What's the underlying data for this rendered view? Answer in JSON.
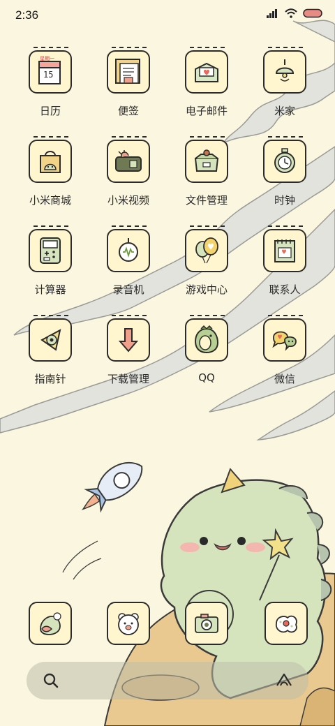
{
  "status_bar": {
    "time": "2:36",
    "battery_color": "#e88b85"
  },
  "apps": [
    {
      "label": "日历",
      "icon": "calendar-icon",
      "badge_text": "星期一",
      "day": "15"
    },
    {
      "label": "便签",
      "icon": "notes-icon"
    },
    {
      "label": "电子邮件",
      "icon": "email-icon"
    },
    {
      "label": "米家",
      "icon": "lamp-icon"
    },
    {
      "label": "小米商城",
      "icon": "shopping-bag-icon"
    },
    {
      "label": "小米视频",
      "icon": "video-icon"
    },
    {
      "label": "文件管理",
      "icon": "folder-box-icon"
    },
    {
      "label": "时钟",
      "icon": "clock-icon"
    },
    {
      "label": "计算器",
      "icon": "calculator-icon"
    },
    {
      "label": "录音机",
      "icon": "recorder-icon"
    },
    {
      "label": "游戏中心",
      "icon": "balloons-icon"
    },
    {
      "label": "联系人",
      "icon": "contacts-icon"
    },
    {
      "label": "指南针",
      "icon": "compass-icon"
    },
    {
      "label": "下载管理",
      "icon": "download-arrow-icon"
    },
    {
      "label": "QQ",
      "icon": "penguin-icon"
    },
    {
      "label": "微信",
      "icon": "chat-bubbles-icon"
    }
  ],
  "dock": [
    {
      "icon": "phone-heart-icon"
    },
    {
      "icon": "bear-face-icon"
    },
    {
      "icon": "camera-icon"
    },
    {
      "icon": "flower-browser-icon"
    }
  ],
  "search": {
    "left_icon": "search-icon",
    "right_icon": "assistant-icon"
  },
  "colors": {
    "background": "#fbf6df",
    "icon_fill": "#fff6cf",
    "icon_border": "#2b2b2b",
    "dino_green": "#d6e4bd",
    "cloud_gray": "#e2e2dc",
    "ground_tan": "#e9c98f"
  }
}
